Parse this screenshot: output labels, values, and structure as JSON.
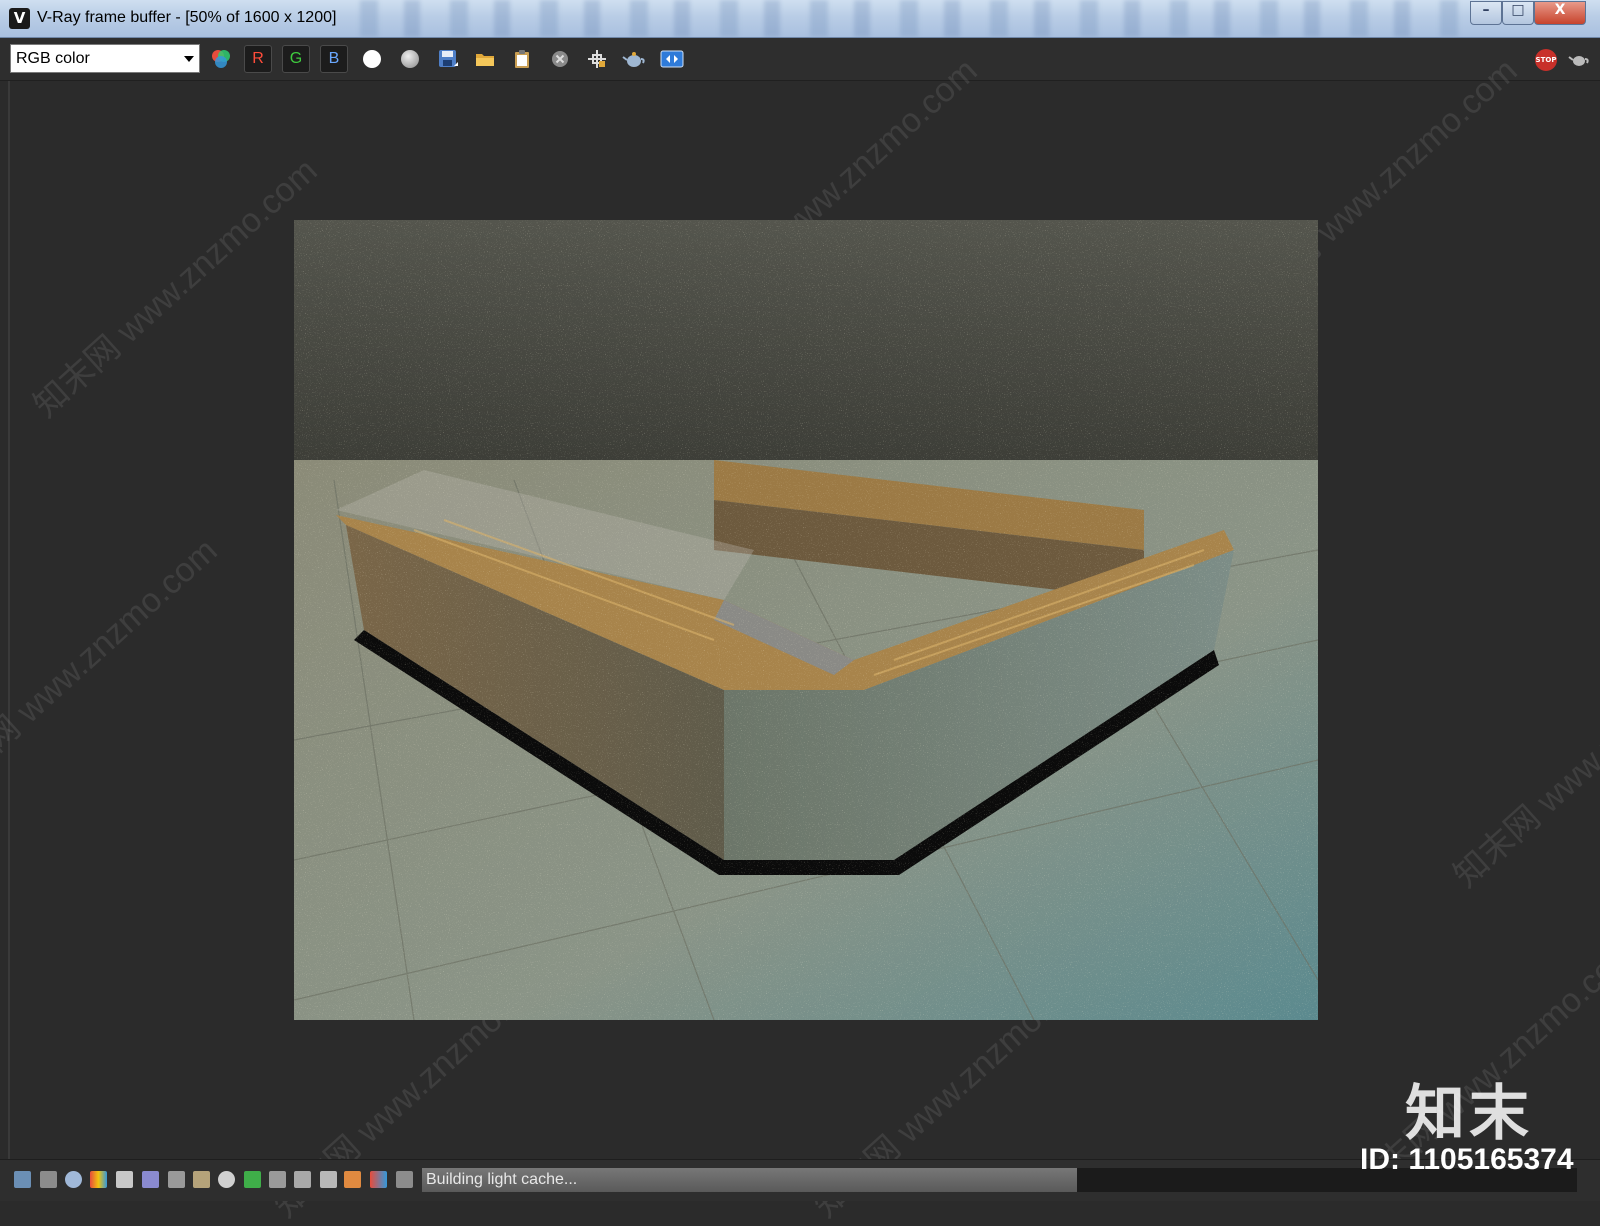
{
  "window": {
    "title": "V-Ray frame buffer - [50% of 1600 x 1200]",
    "app_icon_glyph": "V",
    "minimize_glyph": "–",
    "maximize_glyph": "□",
    "close_glyph": "X"
  },
  "toolbar": {
    "channel_select": "RGB color",
    "red_label": "R",
    "green_label": "G",
    "blue_label": "B",
    "stop_label": "STOP",
    "icons": [
      "color-channels-icon",
      "red-channel-button",
      "green-channel-button",
      "blue-channel-button",
      "alpha-white-icon",
      "mono-gray-icon",
      "save-image-icon",
      "open-image-icon",
      "clipboard-icon",
      "clear-image-icon",
      "track-mouse-icon",
      "render-region-icon",
      "history-icon",
      "stop-render-icon",
      "render-teapot-icon"
    ],
    "colors": {
      "red": "#ff4c3a",
      "green": "#3ec93e",
      "blue": "#6aa8ff",
      "stop": "#c8302a"
    }
  },
  "status": {
    "message": "Building light cache..."
  },
  "watermark": {
    "brand": "知末",
    "id": "ID: 1105165374",
    "site": "知末网 www.znzmo.com"
  }
}
